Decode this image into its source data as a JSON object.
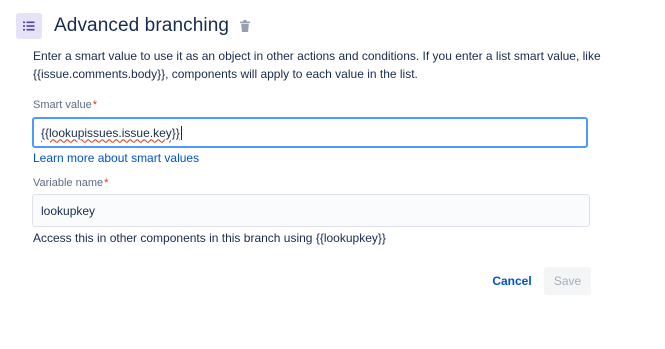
{
  "header": {
    "title": "Advanced branching",
    "branch_icon": "list-icon",
    "delete_icon": "trash-icon"
  },
  "description": "Enter a smart value to use it as an object in other actions and conditions. If you enter a list smart value, like {{issue.comments.body}}, components will apply to each value in the list.",
  "smart_value": {
    "label": "Smart value",
    "required_marker": "*",
    "value": "{{lookupissues.issue.key}}"
  },
  "learn_more_link": "Learn more about smart values",
  "variable_name": {
    "label": "Variable name",
    "required_marker": "*",
    "value": "lookupkey",
    "helper": "Access this in other components in this branch using {{lookupkey}}"
  },
  "actions": {
    "cancel_label": "Cancel",
    "save_label": "Save"
  },
  "colors": {
    "icon_bg": "#e6e2f7",
    "icon_fg": "#5243aa",
    "link": "#0052cc",
    "focus_border": "#4c9aff",
    "required": "#de350b"
  }
}
